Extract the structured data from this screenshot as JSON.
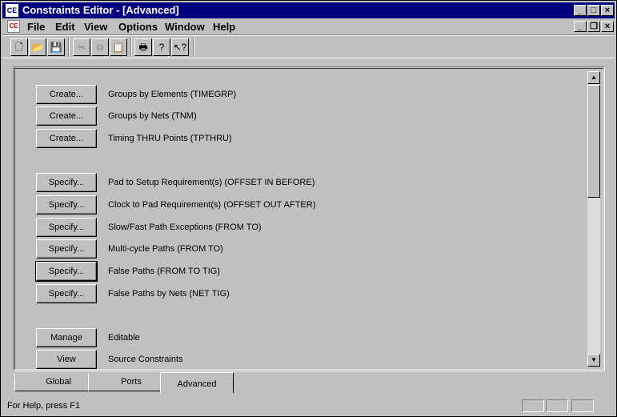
{
  "window": {
    "title": "Constraints Editor - [Advanced]",
    "app_icon_text": "CE",
    "doc_icon_text": "CE",
    "caption_min": "_",
    "caption_max": "□",
    "caption_close": "×",
    "caption_restore": "❐"
  },
  "menubar": {
    "items": [
      "File",
      "Edit",
      "View",
      "Options",
      "Window",
      "Help"
    ]
  },
  "toolbar": {
    "new": "🗋",
    "open": "📂",
    "save": "💾",
    "cut": "✂",
    "copy": "⧉",
    "paste": "📋",
    "print": "🖶",
    "help": "?",
    "context_help": "↖?"
  },
  "rows": {
    "create1": {
      "button": "Create...",
      "label": "Groups by Elements (TIMEGRP)"
    },
    "create2": {
      "button": "Create...",
      "label": "Groups by Nets (TNM)"
    },
    "create3": {
      "button": "Create...",
      "label": "Timing THRU Points (TPTHRU)"
    },
    "spec1": {
      "button": "Specify...",
      "label": "Pad to Setup Requirement(s) (OFFSET IN BEFORE)"
    },
    "spec2": {
      "button": "Specify...",
      "label": "Clock to Pad Requirement(s) (OFFSET OUT AFTER)"
    },
    "spec3": {
      "button": "Specify...",
      "label": "Slow/Fast Path Exceptions (FROM TO)"
    },
    "spec4": {
      "button": "Specify...",
      "label": "Multi-cycle Paths (FROM TO)"
    },
    "spec5": {
      "button": "Specify...",
      "label": "False Paths (FROM TO TIG)"
    },
    "spec6": {
      "button": "Specify...",
      "label": "False Paths by Nets (NET TIG)"
    },
    "manage": {
      "button": "Manage",
      "label": "Editable"
    },
    "view": {
      "button": "View",
      "label": "Source Constraints"
    }
  },
  "scrollbar": {
    "up": "▲",
    "down": "▼"
  },
  "tabs": [
    "Global",
    "Ports",
    "Advanced"
  ],
  "active_tab": "Advanced",
  "status": {
    "text": "For Help, press F1"
  }
}
